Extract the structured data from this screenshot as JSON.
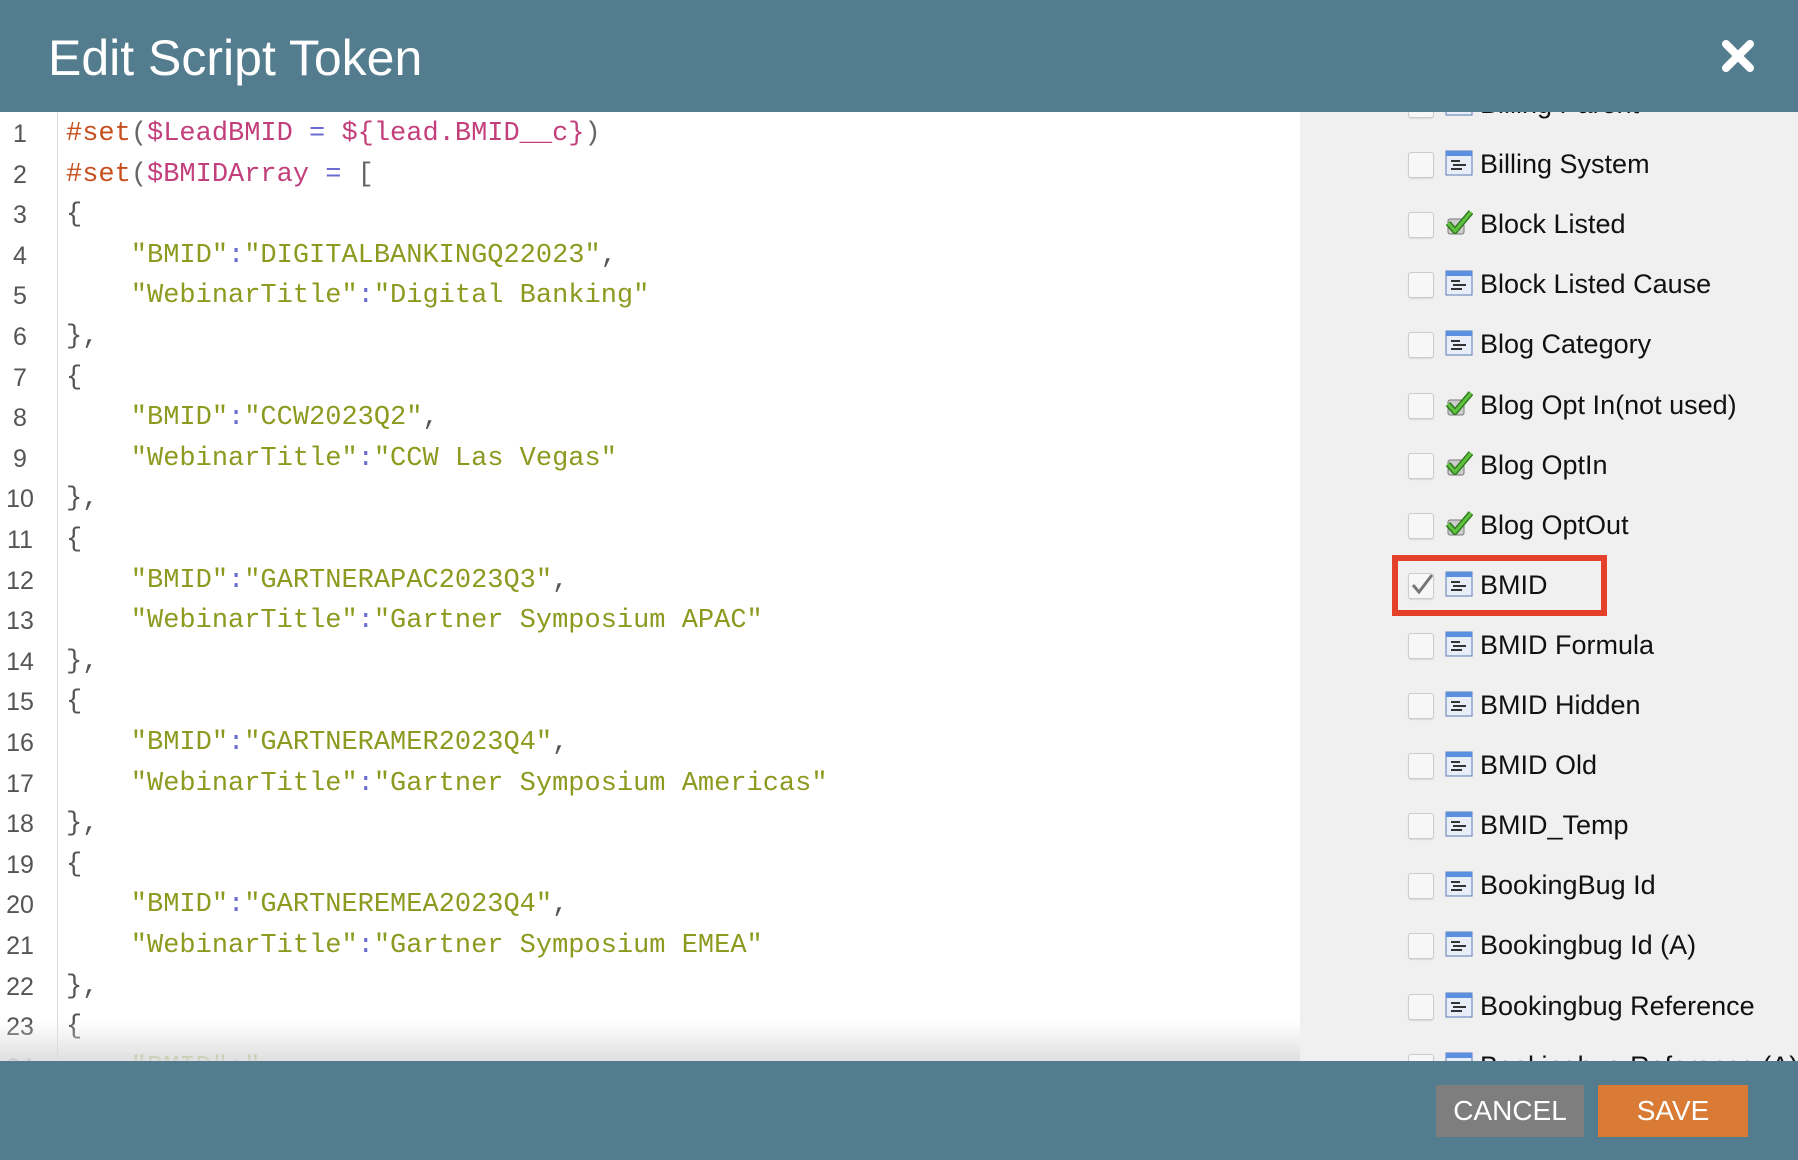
{
  "dialog": {
    "title": "Edit Script Token",
    "close_icon": "close-icon"
  },
  "colors": {
    "header": "#537d8e",
    "save": "#d97a35",
    "cancel": "#7e7e7e",
    "highlight": "#e5402a"
  },
  "editor": {
    "lines": [
      [
        {
          "t": "#set",
          "c": "d"
        },
        {
          "t": "(",
          "c": "p"
        },
        {
          "t": "$LeadBMID",
          "c": "v"
        },
        {
          "t": " = ",
          "c": "o"
        },
        {
          "t": "${lead.BMID__c}",
          "c": "v"
        },
        {
          "t": ")",
          "c": "p"
        }
      ],
      [
        {
          "t": "#set",
          "c": "d"
        },
        {
          "t": "(",
          "c": "p"
        },
        {
          "t": "$BMIDArray",
          "c": "v"
        },
        {
          "t": " = ",
          "c": "o"
        },
        {
          "t": "[",
          "c": "p"
        }
      ],
      [
        {
          "t": "{",
          "c": "b"
        }
      ],
      [
        {
          "t": "    \"BMID\"",
          "c": "s"
        },
        {
          "t": ":",
          "c": "o"
        },
        {
          "t": "\"DIGITALBANKINGQ22023\"",
          "c": "s"
        },
        {
          "t": ",",
          "c": "b"
        }
      ],
      [
        {
          "t": "    \"WebinarTitle\"",
          "c": "s"
        },
        {
          "t": ":",
          "c": "o"
        },
        {
          "t": "\"Digital Banking\"",
          "c": "s"
        }
      ],
      [
        {
          "t": "},",
          "c": "b"
        }
      ],
      [
        {
          "t": "{",
          "c": "b"
        }
      ],
      [
        {
          "t": "    \"BMID\"",
          "c": "s"
        },
        {
          "t": ":",
          "c": "o"
        },
        {
          "t": "\"CCW2023Q2\"",
          "c": "s"
        },
        {
          "t": ",",
          "c": "b"
        }
      ],
      [
        {
          "t": "    \"WebinarTitle\"",
          "c": "s"
        },
        {
          "t": ":",
          "c": "o"
        },
        {
          "t": "\"CCW Las Vegas\"",
          "c": "s"
        }
      ],
      [
        {
          "t": "},",
          "c": "b"
        }
      ],
      [
        {
          "t": "{",
          "c": "b"
        }
      ],
      [
        {
          "t": "    \"BMID\"",
          "c": "s"
        },
        {
          "t": ":",
          "c": "o"
        },
        {
          "t": "\"GARTNERAPAC2023Q3\"",
          "c": "s"
        },
        {
          "t": ",",
          "c": "b"
        }
      ],
      [
        {
          "t": "    \"WebinarTitle\"",
          "c": "s"
        },
        {
          "t": ":",
          "c": "o"
        },
        {
          "t": "\"Gartner Symposium APAC\"",
          "c": "s"
        }
      ],
      [
        {
          "t": "},",
          "c": "b"
        }
      ],
      [
        {
          "t": "{",
          "c": "b"
        }
      ],
      [
        {
          "t": "    \"BMID\"",
          "c": "s"
        },
        {
          "t": ":",
          "c": "o"
        },
        {
          "t": "\"GARTNERAMER2023Q4\"",
          "c": "s"
        },
        {
          "t": ",",
          "c": "b"
        }
      ],
      [
        {
          "t": "    \"WebinarTitle\"",
          "c": "s"
        },
        {
          "t": ":",
          "c": "o"
        },
        {
          "t": "\"Gartner Symposium Americas\"",
          "c": "s"
        }
      ],
      [
        {
          "t": "},",
          "c": "b"
        }
      ],
      [
        {
          "t": "{",
          "c": "b"
        }
      ],
      [
        {
          "t": "    \"BMID\"",
          "c": "s"
        },
        {
          "t": ":",
          "c": "o"
        },
        {
          "t": "\"GARTNEREMEA2023Q4\"",
          "c": "s"
        },
        {
          "t": ",",
          "c": "b"
        }
      ],
      [
        {
          "t": "    \"WebinarTitle\"",
          "c": "s"
        },
        {
          "t": ":",
          "c": "o"
        },
        {
          "t": "\"Gartner Symposium EMEA\"",
          "c": "s"
        }
      ],
      [
        {
          "t": "},",
          "c": "b"
        }
      ],
      [
        {
          "t": "{",
          "c": "b"
        }
      ],
      [
        {
          "t": "    \"BMID\"",
          "c": "s"
        },
        {
          "t": ":",
          "c": "o"
        },
        {
          "t": "\"",
          "c": "s"
        }
      ]
    ]
  },
  "fields": [
    {
      "label": "Billing Parent",
      "icon": "field",
      "checked": false
    },
    {
      "label": "Billing System",
      "icon": "field",
      "checked": false
    },
    {
      "label": "Block Listed",
      "icon": "boolean",
      "checked": false
    },
    {
      "label": "Block Listed Cause",
      "icon": "field",
      "checked": false
    },
    {
      "label": "Blog Category",
      "icon": "field",
      "checked": false
    },
    {
      "label": "Blog Opt In(not used)",
      "icon": "boolean",
      "checked": false
    },
    {
      "label": "Blog OptIn",
      "icon": "boolean",
      "checked": false
    },
    {
      "label": "Blog OptOut",
      "icon": "boolean",
      "checked": false
    },
    {
      "label": "BMID",
      "icon": "field",
      "checked": true,
      "highlighted": true
    },
    {
      "label": "BMID Formula",
      "icon": "field",
      "checked": false
    },
    {
      "label": "BMID Hidden",
      "icon": "field",
      "checked": false
    },
    {
      "label": "BMID Old",
      "icon": "field",
      "checked": false
    },
    {
      "label": "BMID_Temp",
      "icon": "field",
      "checked": false
    },
    {
      "label": "BookingBug Id",
      "icon": "field",
      "checked": false
    },
    {
      "label": "Bookingbug Id (A)",
      "icon": "field",
      "checked": false
    },
    {
      "label": "Bookingbug Reference",
      "icon": "field",
      "checked": false
    },
    {
      "label": "Bookingbug Reference (A)",
      "icon": "field",
      "checked": false
    }
  ],
  "footer": {
    "cancel_label": "CANCEL",
    "save_label": "SAVE"
  }
}
